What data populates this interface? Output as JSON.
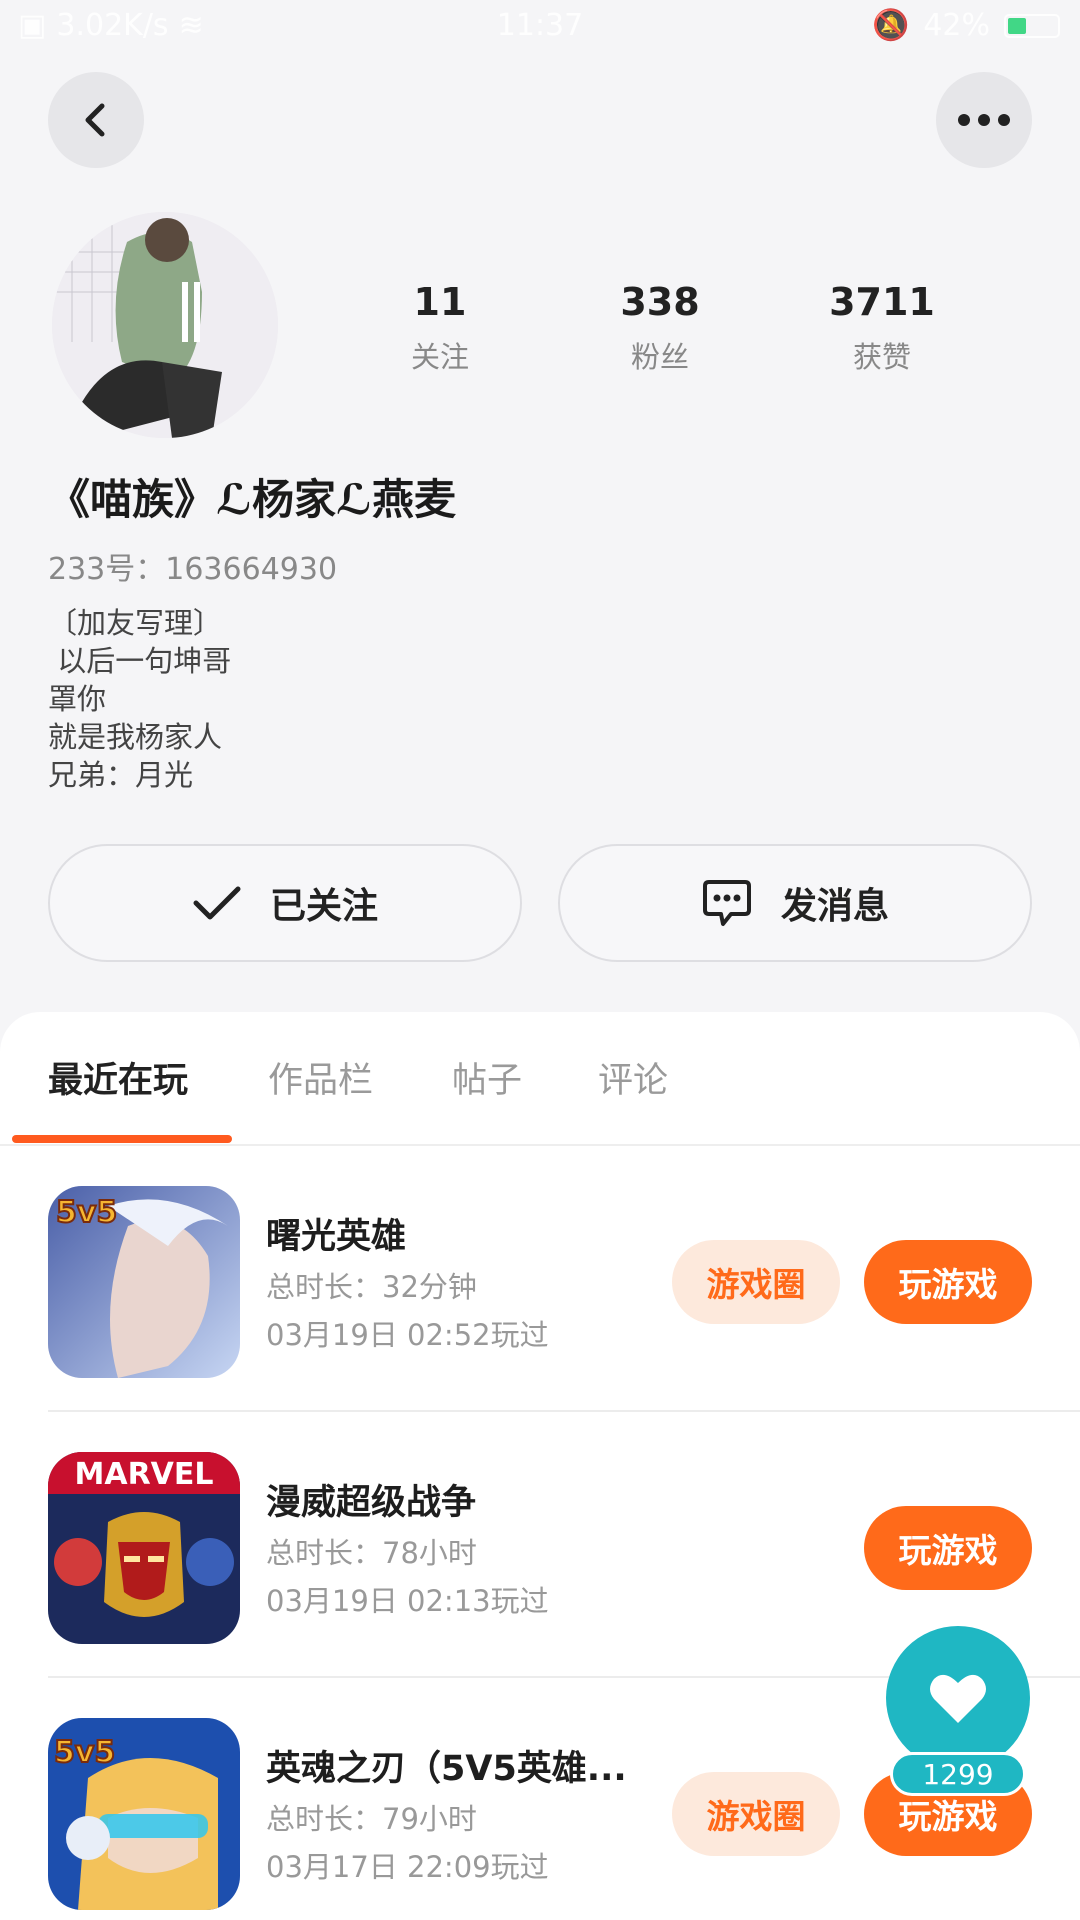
{
  "status_bar": {
    "speed": "3.02K/s",
    "time": "11:37",
    "battery": "42%"
  },
  "profile": {
    "stats": [
      {
        "value": "11",
        "label": "关注"
      },
      {
        "value": "338",
        "label": "粉丝"
      },
      {
        "value": "3711",
        "label": "获赞"
      }
    ],
    "username": "《喵族》ℒ杨家ℒ燕麦",
    "user_id": "233号：163664930",
    "bio": "〔加友写理〕\n 以后一句坤哥\n罩你\n就是我杨家人\n兄弟：月光",
    "follow_button": "已关注",
    "message_button": "发消息"
  },
  "tabs": [
    "最近在玩",
    "作品栏",
    "帖子",
    "评论"
  ],
  "games": [
    {
      "title": "曙光英雄",
      "duration": "总时长：32分钟",
      "last_played": "03月19日 02:52玩过",
      "circle_label": "游戏圈",
      "play_label": "玩游戏"
    },
    {
      "title": "漫威超级战争",
      "duration": "总时长：78小时",
      "last_played": "03月19日 02:13玩过",
      "play_label": "玩游戏"
    },
    {
      "title": "英魂之刃（5V5英雄...",
      "duration": "总时长：79小时",
      "last_played": "03月17日 22:09玩过",
      "circle_label": "游戏圈",
      "play_label": "玩游戏"
    }
  ],
  "icons": {
    "game1": {
      "badge": "5v5"
    },
    "game2": {
      "badge": "MARVEL"
    },
    "game3": {
      "badge": "5v5"
    }
  },
  "like": {
    "count": "1299"
  },
  "colors": {
    "accent": "#ff6a1a",
    "tab_indicator": "#ff5a1f",
    "like": "#1fb7c3"
  }
}
